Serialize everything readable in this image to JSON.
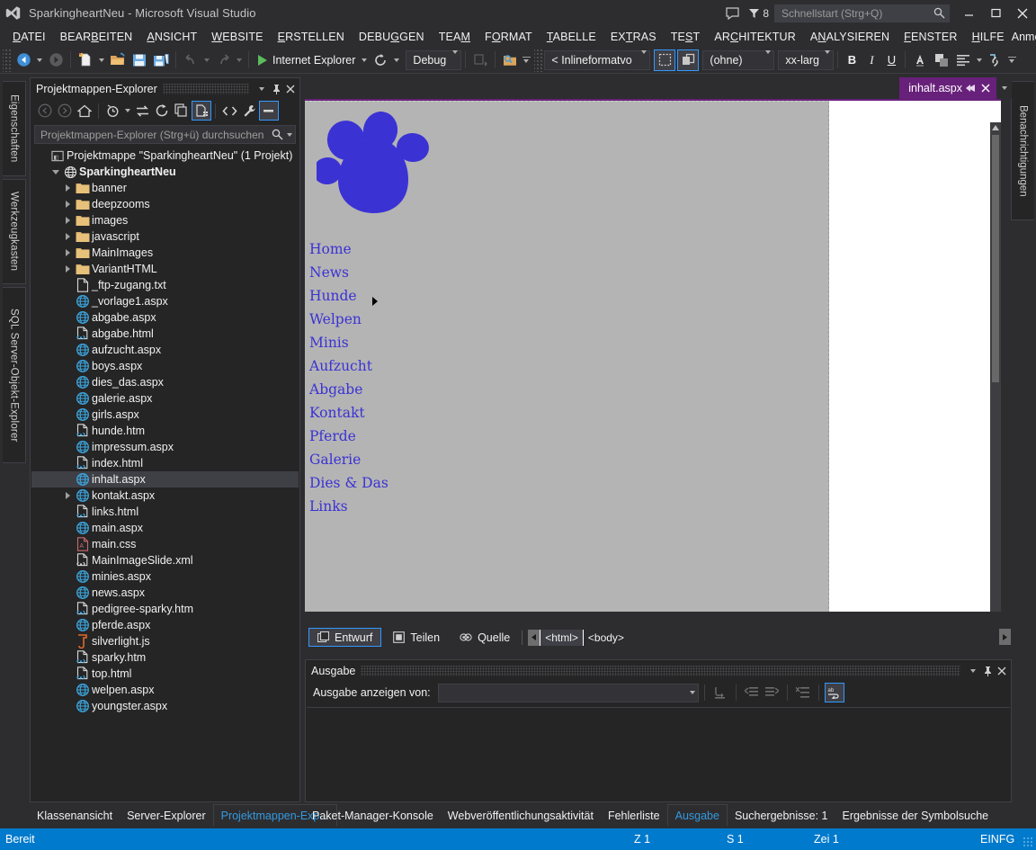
{
  "window": {
    "title": "SparkingheartNeu - Microsoft Visual Studio",
    "feedback_count": "8",
    "quicklaunch_placeholder": "Schnellstart (Strg+Q)",
    "minimize": "—",
    "maximize": "☐",
    "close": "✕"
  },
  "menubar": {
    "items": [
      {
        "label": "DATEI",
        "accel": "D"
      },
      {
        "label": "BEARBEITEN",
        "accel": "B"
      },
      {
        "label": "ANSICHT",
        "accel": "A"
      },
      {
        "label": "WEBSITE",
        "accel": "W"
      },
      {
        "label": "ERSTELLEN",
        "accel": "E"
      },
      {
        "label": "DEBUGGEN",
        "accel": "G"
      },
      {
        "label": "TEAM",
        "accel": "M"
      },
      {
        "label": "FORMAT",
        "accel": "O"
      },
      {
        "label": "TABELLE",
        "accel": "T"
      },
      {
        "label": "EXTRAS",
        "accel": "R"
      },
      {
        "label": "TEST",
        "accel": "S"
      },
      {
        "label": "ARCHITEKTUR",
        "accel": "C"
      },
      {
        "label": "ANALYSIEREN",
        "accel": "N"
      },
      {
        "label": "FENSTER",
        "accel": "F"
      },
      {
        "label": "HILFE",
        "accel": "H"
      }
    ],
    "signin": "Anmelden"
  },
  "toolbar": {
    "run_target": "Internet Explorer",
    "configuration": "Debug",
    "format_combo": "< Inlineformatvo",
    "none_combo": "(ohne)",
    "size_combo": "xx-large",
    "bold": "B",
    "italic": "I",
    "underline": "U"
  },
  "left_tabs": [
    {
      "label": "Eigenschaften"
    },
    {
      "label": "Werkzeugkasten"
    },
    {
      "label": "SQL Server-Objekt-Explorer"
    }
  ],
  "right_tabs": [
    {
      "label": "Benachrichtigungen"
    }
  ],
  "solution_explorer": {
    "title": "Projektmappen-Explorer",
    "search_placeholder": "Projektmappen-Explorer (Strg+ü) durchsuchen",
    "tree": [
      {
        "label": "Projektmappe \"SparkingheartNeu\" (1 Projekt)",
        "indent": 0,
        "twist": "none",
        "icon": "solution-icon",
        "bold": false,
        "selected": false
      },
      {
        "label": "SparkingheartNeu",
        "indent": 1,
        "twist": "down",
        "icon": "web-project-icon",
        "bold": true,
        "selected": false
      },
      {
        "label": "banner",
        "indent": 2,
        "twist": "right",
        "icon": "folder-icon",
        "bold": false,
        "selected": false
      },
      {
        "label": "deepzooms",
        "indent": 2,
        "twist": "right",
        "icon": "folder-icon",
        "bold": false,
        "selected": false
      },
      {
        "label": "images",
        "indent": 2,
        "twist": "right",
        "icon": "folder-icon",
        "bold": false,
        "selected": false
      },
      {
        "label": "javascript",
        "indent": 2,
        "twist": "right",
        "icon": "folder-icon",
        "bold": false,
        "selected": false
      },
      {
        "label": "MainImages",
        "indent": 2,
        "twist": "right",
        "icon": "folder-icon",
        "bold": false,
        "selected": false
      },
      {
        "label": "VariantHTML",
        "indent": 2,
        "twist": "right",
        "icon": "folder-icon",
        "bold": false,
        "selected": false
      },
      {
        "label": "_ftp-zugang.txt",
        "indent": 2,
        "twist": "none",
        "icon": "text-file-icon",
        "bold": false,
        "selected": false
      },
      {
        "label": "_vorlage1.aspx",
        "indent": 2,
        "twist": "none",
        "icon": "aspx-file-icon",
        "bold": false,
        "selected": false
      },
      {
        "label": "abgabe.aspx",
        "indent": 2,
        "twist": "none",
        "icon": "aspx-file-icon",
        "bold": false,
        "selected": false
      },
      {
        "label": "abgabe.html",
        "indent": 2,
        "twist": "none",
        "icon": "html-file-icon",
        "bold": false,
        "selected": false
      },
      {
        "label": "aufzucht.aspx",
        "indent": 2,
        "twist": "none",
        "icon": "aspx-file-icon",
        "bold": false,
        "selected": false
      },
      {
        "label": "boys.aspx",
        "indent": 2,
        "twist": "none",
        "icon": "aspx-file-icon",
        "bold": false,
        "selected": false
      },
      {
        "label": "dies_das.aspx",
        "indent": 2,
        "twist": "none",
        "icon": "aspx-file-icon",
        "bold": false,
        "selected": false
      },
      {
        "label": "galerie.aspx",
        "indent": 2,
        "twist": "none",
        "icon": "aspx-file-icon",
        "bold": false,
        "selected": false
      },
      {
        "label": "girls.aspx",
        "indent": 2,
        "twist": "none",
        "icon": "aspx-file-icon",
        "bold": false,
        "selected": false
      },
      {
        "label": "hunde.htm",
        "indent": 2,
        "twist": "none",
        "icon": "html-file-icon",
        "bold": false,
        "selected": false
      },
      {
        "label": "impressum.aspx",
        "indent": 2,
        "twist": "none",
        "icon": "aspx-file-icon",
        "bold": false,
        "selected": false
      },
      {
        "label": "index.html",
        "indent": 2,
        "twist": "none",
        "icon": "html-file-icon",
        "bold": false,
        "selected": false
      },
      {
        "label": "inhalt.aspx",
        "indent": 2,
        "twist": "none",
        "icon": "aspx-file-icon",
        "bold": false,
        "selected": true
      },
      {
        "label": "kontakt.aspx",
        "indent": 2,
        "twist": "right",
        "icon": "aspx-file-icon",
        "bold": false,
        "selected": false
      },
      {
        "label": "links.html",
        "indent": 2,
        "twist": "none",
        "icon": "html-file-icon",
        "bold": false,
        "selected": false
      },
      {
        "label": "main.aspx",
        "indent": 2,
        "twist": "none",
        "icon": "aspx-file-icon",
        "bold": false,
        "selected": false
      },
      {
        "label": "main.css",
        "indent": 2,
        "twist": "none",
        "icon": "css-file-icon",
        "bold": false,
        "selected": false
      },
      {
        "label": "MainImageSlide.xml",
        "indent": 2,
        "twist": "none",
        "icon": "xml-file-icon",
        "bold": false,
        "selected": false
      },
      {
        "label": "minies.aspx",
        "indent": 2,
        "twist": "none",
        "icon": "aspx-file-icon",
        "bold": false,
        "selected": false
      },
      {
        "label": "news.aspx",
        "indent": 2,
        "twist": "none",
        "icon": "aspx-file-icon",
        "bold": false,
        "selected": false
      },
      {
        "label": "pedigree-sparky.htm",
        "indent": 2,
        "twist": "none",
        "icon": "html-file-icon",
        "bold": false,
        "selected": false
      },
      {
        "label": "pferde.aspx",
        "indent": 2,
        "twist": "none",
        "icon": "aspx-file-icon",
        "bold": false,
        "selected": false
      },
      {
        "label": "silverlight.js",
        "indent": 2,
        "twist": "none",
        "icon": "js-file-icon",
        "bold": false,
        "selected": false
      },
      {
        "label": "sparky.htm",
        "indent": 2,
        "twist": "none",
        "icon": "html-file-icon",
        "bold": false,
        "selected": false
      },
      {
        "label": "top.html",
        "indent": 2,
        "twist": "none",
        "icon": "html-file-icon",
        "bold": false,
        "selected": false
      },
      {
        "label": "welpen.aspx",
        "indent": 2,
        "twist": "none",
        "icon": "aspx-file-icon",
        "bold": false,
        "selected": false
      },
      {
        "label": "youngster.aspx",
        "indent": 2,
        "twist": "none",
        "icon": "aspx-file-icon",
        "bold": false,
        "selected": false
      }
    ]
  },
  "document": {
    "tab_name": "inhalt.aspx",
    "tab_close": "✕",
    "accent_color": "#68217a"
  },
  "designer": {
    "nav_color": "#3b32d4",
    "page_bg": "#b4b4b4",
    "nav_items": [
      {
        "label": "Home",
        "submenu": false
      },
      {
        "label": "News",
        "submenu": false
      },
      {
        "label": "Hunde",
        "submenu": true
      },
      {
        "label": "Welpen",
        "submenu": false
      },
      {
        "label": "Minis",
        "submenu": false
      },
      {
        "label": "Aufzucht",
        "submenu": false
      },
      {
        "label": "Abgabe",
        "submenu": false
      },
      {
        "label": "Kontakt",
        "submenu": false
      },
      {
        "label": "Pferde",
        "submenu": false
      },
      {
        "label": "Galerie",
        "submenu": false
      },
      {
        "label": "Dies & Das",
        "submenu": false
      },
      {
        "label": "Links",
        "submenu": false
      }
    ]
  },
  "view_tabs": {
    "design": "Entwurf",
    "split": "Teilen",
    "source": "Quelle",
    "breadcrumb": [
      "<html>",
      "<body>"
    ]
  },
  "output_panel": {
    "title": "Ausgabe",
    "show_output_from_label": "Ausgabe anzeigen von:",
    "combo_value": ""
  },
  "bottom_tabs_left": [
    {
      "label": "Klassenansicht",
      "active": false
    },
    {
      "label": "Server-Explorer",
      "active": false
    },
    {
      "label": "Projektmappen-Exp...",
      "active": true
    }
  ],
  "bottom_tabs_right": [
    {
      "label": "Paket-Manager-Konsole",
      "active": false
    },
    {
      "label": "Webveröffentlichungsaktivität",
      "active": false
    },
    {
      "label": "Fehlerliste",
      "active": false
    },
    {
      "label": "Ausgabe",
      "active": true
    },
    {
      "label": "Suchergebnisse: 1",
      "active": false
    },
    {
      "label": "Ergebnisse der Symbolsuche",
      "active": false
    }
  ],
  "statusbar": {
    "state": "Bereit",
    "line": "Z 1",
    "column": "S 1",
    "char": "Zei 1",
    "insert_mode": "EINFG",
    "color": "#007acc"
  }
}
